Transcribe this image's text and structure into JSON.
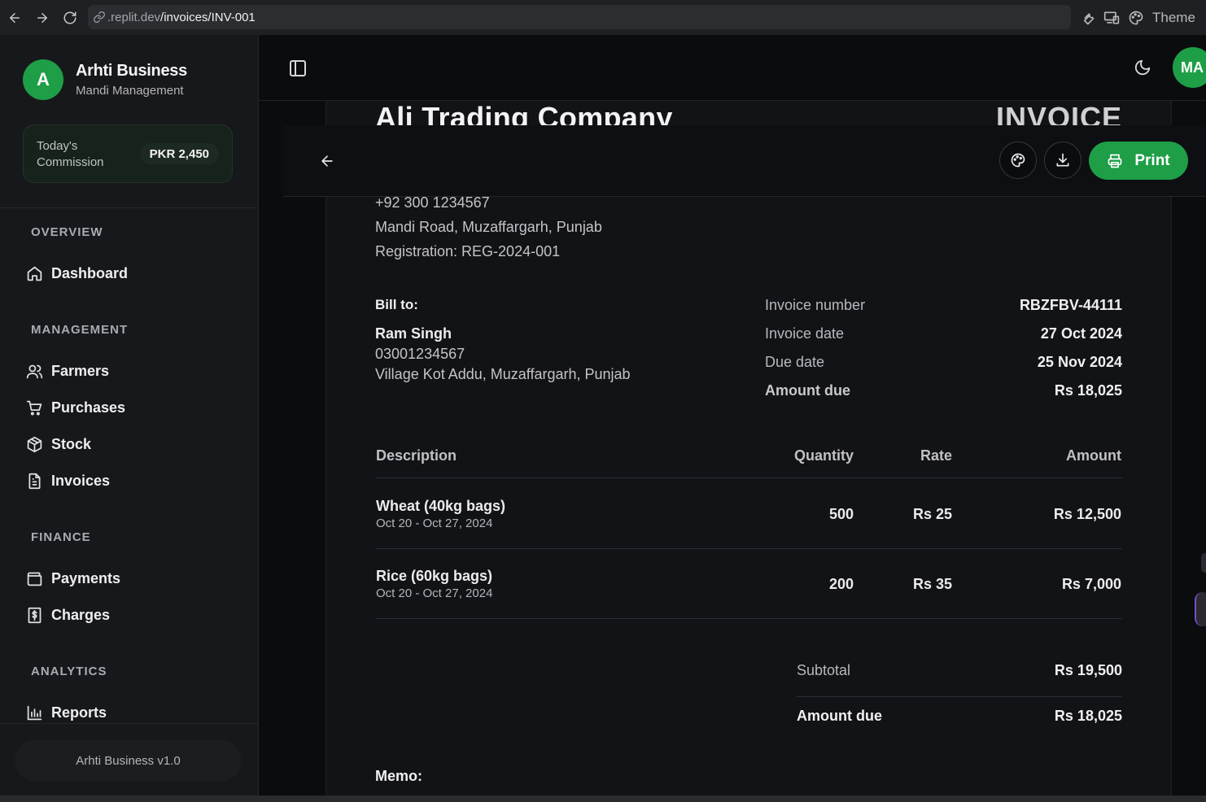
{
  "browser": {
    "url_host": ".replit.dev",
    "url_path": "/invoices/INV-001",
    "theme_label": "Theme"
  },
  "sidebar": {
    "brand_initial": "A",
    "brand_name": "Arhti Business",
    "brand_subtitle": "Mandi Management",
    "commission_label": "Today's Commission",
    "commission_value": "PKR 2,450",
    "sections": {
      "overview": "OVERVIEW",
      "management": "MANAGEMENT",
      "finance": "FINANCE",
      "analytics": "ANALYTICS"
    },
    "items": {
      "dashboard": "Dashboard",
      "farmers": "Farmers",
      "purchases": "Purchases",
      "stock": "Stock",
      "invoices": "Invoices",
      "payments": "Payments",
      "charges": "Charges",
      "reports": "Reports"
    },
    "version": "Arhti Business v1.0"
  },
  "header": {
    "user_initials": "MA"
  },
  "toolbar": {
    "print_label": "Print"
  },
  "invoice": {
    "company_name": "Ali Trading Company",
    "title_word": "INVOICE",
    "company_phone": "+92 300 1234567",
    "company_address": "Mandi Road, Muzaffargarh, Punjab",
    "company_registration": "Registration: REG-2024-001",
    "bill_to_label": "Bill to:",
    "customer_name": "Ram Singh",
    "customer_phone": "03001234567",
    "customer_address": "Village Kot Addu, Muzaffargarh, Punjab",
    "meta": {
      "number_label": "Invoice number",
      "number_value": "RBZFBV-44111",
      "date_label": "Invoice date",
      "date_value": "27 Oct 2024",
      "due_label": "Due date",
      "due_value": "25 Nov 2024",
      "amount_due_label": "Amount due",
      "amount_due_value": "Rs 18,025"
    },
    "columns": {
      "description": "Description",
      "quantity": "Quantity",
      "rate": "Rate",
      "amount": "Amount"
    },
    "items": [
      {
        "description": "Wheat (40kg bags)",
        "period": "Oct 20 - Oct 27, 2024",
        "quantity": "500",
        "rate": "Rs 25",
        "amount": "Rs 12,500"
      },
      {
        "description": "Rice (60kg bags)",
        "period": "Oct 20 - Oct 27, 2024",
        "quantity": "200",
        "rate": "Rs 35",
        "amount": "Rs 7,000"
      }
    ],
    "subtotal_label": "Subtotal",
    "subtotal_value": "Rs 19,500",
    "total_due_label": "Amount due",
    "total_due_value": "Rs 18,025",
    "memo_label": "Memo:"
  },
  "colors": {
    "accent": "#1e9e47",
    "background": "#0b0c0e",
    "sidebar": "#17181b",
    "paper": "#121317"
  },
  "icons": [
    "back-icon",
    "forward-icon",
    "reload-icon",
    "link-icon",
    "wrench-icon",
    "devices-icon",
    "palette-icon",
    "sidebar-toggle-icon",
    "moon-icon",
    "home-icon",
    "users-icon",
    "cart-icon",
    "box-icon",
    "file-text-icon",
    "wallet-icon",
    "receipt-icon",
    "bar-chart-icon",
    "arrow-left-icon",
    "download-icon",
    "printer-icon"
  ]
}
